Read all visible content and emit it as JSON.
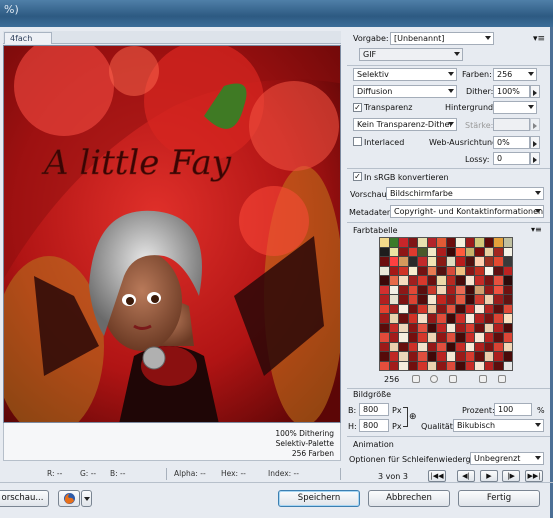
{
  "window": {
    "title_fragment": "%)",
    "tab_label": "4fach"
  },
  "image": {
    "overlay_text": "A little Fay"
  },
  "optimize_info": {
    "line1": "100% Dithering",
    "line2": "Selektiv-Palette",
    "line3": "256 Farben"
  },
  "statusbar": {
    "r": "R: --",
    "g": "G: --",
    "b": "B: --",
    "alpha": "Alpha: --",
    "hex": "Hex: --",
    "index": "Index: --"
  },
  "buttons": {
    "preview": "orschau...",
    "save": "Speichern",
    "cancel": "Abbrechen",
    "done": "Fertig"
  },
  "panel": {
    "preset_label": "Vorgabe:",
    "preset_value": "[Unbenannt]",
    "format": "GIF",
    "reduction": "Selektiv",
    "colors_label": "Farben:",
    "colors_value": "256",
    "dither_algo": "Diffusion",
    "dither_label": "Dither:",
    "dither_value": "100%",
    "transparency_label": "Transparenz",
    "transparency_checked": true,
    "matte_label": "Hintergrund:",
    "trans_dither": "Kein Transparenz-Dither",
    "amount_label": "Stärke:",
    "interlaced_label": "Interlaced",
    "interlaced_checked": false,
    "websnap_label": "Web-Ausrichtung:",
    "websnap_value": "0%",
    "lossy_label": "Lossy:",
    "lossy_value": "0",
    "srgb_label": "In sRGB konvertieren",
    "srgb_checked": true,
    "preview_label": "Vorschau:",
    "preview_value": "Bildschirmfarbe",
    "metadata_label": "Metadaten:",
    "metadata_value": "Copyright- und Kontaktinformationen",
    "colortable_title": "Farbtabelle",
    "colortable_count": "256",
    "imagesize_title": "Bildgröße",
    "width_label": "B:",
    "width_value": "800",
    "width_unit": "Px",
    "height_label": "H:",
    "height_value": "800",
    "height_unit": "Px",
    "percent_label": "Prozent:",
    "percent_value": "100",
    "percent_unit": "%",
    "quality_label": "Qualität:",
    "quality_value": "Bikubisch",
    "animation_title": "Animation",
    "loop_label": "Optionen für Schleifenwiedergabe:",
    "loop_value": "Unbegrenzt",
    "frame_counter": "3 von 3"
  },
  "palette_colors": [
    "#f2d98a",
    "#3b7a2a",
    "#c8262a",
    "#7f1616",
    "#e8e1b0",
    "#b3232a",
    "#e25a35",
    "#6d0e0d",
    "#f4f0dc",
    "#9a1b1b",
    "#d2c87a",
    "#5e0b0a",
    "#e6a13a",
    "#c0c0a0",
    "#1d1d1d",
    "#eae3a2",
    "#8d1615",
    "#e03a2e",
    "#4a5a2a",
    "#f2e9c7",
    "#ad1e1e",
    "#3c0606",
    "#ff5a3c",
    "#c8b16a",
    "#7c0d0c",
    "#e8d0a0",
    "#a2271f",
    "#f6f3e6",
    "#6b0d0d",
    "#ff4040",
    "#d49a5c",
    "#2a2a2a",
    "#c22a2a",
    "#f1e4b4",
    "#8a1a14",
    "#e0dcc0",
    "#b81c1c",
    "#51100e",
    "#ffd0b0",
    "#9c3020",
    "#e44a30",
    "#3a3a3a",
    "#e8e8d8",
    "#a51817",
    "#cf3326",
    "#f7eed0",
    "#731212",
    "#e77b52",
    "#541010",
    "#d64a3a",
    "#f0c080",
    "#871616",
    "#c03020",
    "#fbf7ea",
    "#611010",
    "#bd2221",
    "#3a0808",
    "#e66a4a",
    "#f5dcc0",
    "#9f1f1f",
    "#d8382c",
    "#6a1010",
    "#ecd9a8",
    "#b82a22",
    "#490b0a",
    "#f8e4d0",
    "#c42b27",
    "#7a1413",
    "#e5503e",
    "#2e0a0a",
    "#d22f2f",
    "#f3f0e6",
    "#8e1817",
    "#e04836",
    "#5b0e0d",
    "#c93a2c",
    "#f1d8b8",
    "#a61d1c",
    "#e86b54",
    "#430908",
    "#d1a070",
    "#951a19",
    "#ef5240",
    "#6f1110",
    "#b02020",
    "#e7e2d0",
    "#7d1312",
    "#db4232",
    "#540c0b",
    "#f5e8d0",
    "#c3261f",
    "#8b1716",
    "#e45a42",
    "#3d0807",
    "#ce3c30",
    "#f0d0b0",
    "#9a1c1b",
    "#611312",
    "#e3412f",
    "#a71e1d",
    "#f7f1e4",
    "#700f0f",
    "#d33528",
    "#ecc8a0",
    "#891514",
    "#e25440",
    "#480a09",
    "#c72a24",
    "#fae8d8",
    "#b42321",
    "#5c0d0c",
    "#de4a38",
    "#a01b1a",
    "#e9d4b0",
    "#6a0f0e",
    "#d03126",
    "#f4e0c8",
    "#921817",
    "#e04c3a",
    "#3f0807",
    "#cb2e28",
    "#f8ecde",
    "#b3201f",
    "#781211",
    "#dc4434",
    "#fae0c0",
    "#5a0c0b",
    "#c52a26",
    "#eed8bc",
    "#881514",
    "#e25040",
    "#420808",
    "#bf2522",
    "#f5ead8",
    "#9e1b1a",
    "#d83c30",
    "#6c0f0e",
    "#ecd0b0",
    "#b01f1e",
    "#4c0a09",
    "#e14a3a",
    "#a31c1b",
    "#f6eedf",
    "#740f0e",
    "#d4362b",
    "#efd4b4",
    "#8f1615",
    "#df4e3c",
    "#460908",
    "#c92c27",
    "#f9e8d6",
    "#b72220",
    "#5f0d0c",
    "#dd4636",
    "#9c1a19",
    "#eacfad",
    "#670e0d",
    "#cc3027",
    "#f3e2cc",
    "#941817",
    "#e24e3d",
    "#3b0706",
    "#c52b26",
    "#f7ead9",
    "#ae1f1e",
    "#7c1211",
    "#da4233",
    "#f1d6b6",
    "#560b0a",
    "#c02724",
    "#ecd6b8",
    "#861514",
    "#e04e3e",
    "#420808",
    "#bb2422",
    "#f4e8d4",
    "#991a19",
    "#d63a2e",
    "#690e0d",
    "#ebcdad",
    "#ac1e1d",
    "#490a09",
    "#e44e3c",
    "#a21c1b",
    "#f6ecdc",
    "#710f0e",
    "#d2342a",
    "#edd2b0",
    "#8d1615",
    "#de4a3a",
    "#440908",
    "#c72b26",
    "#f8e6d4",
    "#b42120",
    "#5d0d0c",
    "#e5e5e5"
  ]
}
